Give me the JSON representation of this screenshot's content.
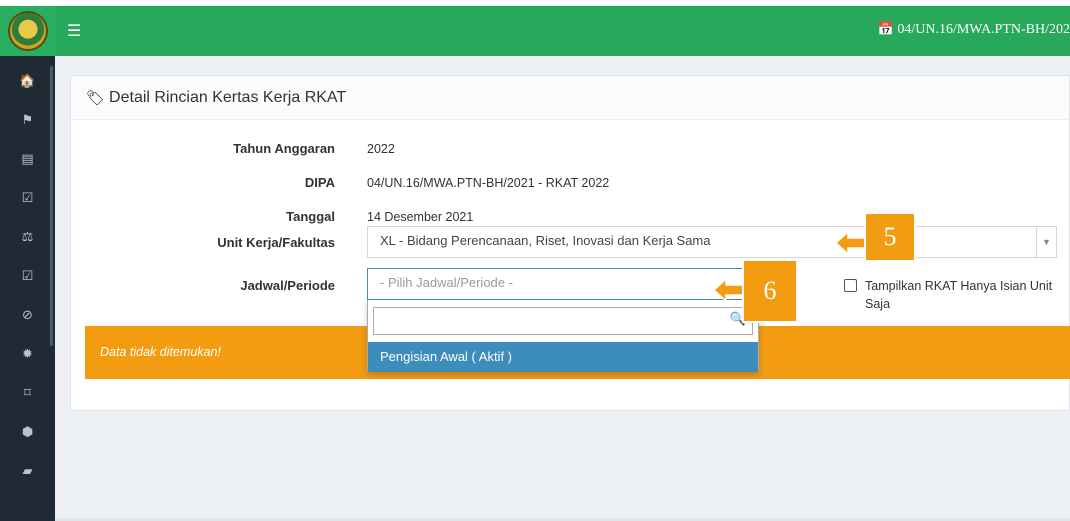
{
  "topbar": {
    "menu_icon": "hamburger-icon",
    "right_icon": "calendar-icon",
    "right_text": "04/UN.16/MWA.PTN-BH/202"
  },
  "sidebar": {
    "items": [
      {
        "icon": "home-icon",
        "glyph": "🏠"
      },
      {
        "icon": "flag-icon",
        "glyph": "⚑"
      },
      {
        "icon": "file-icon",
        "glyph": "▤"
      },
      {
        "icon": "check-square-icon",
        "glyph": "☑"
      },
      {
        "icon": "balance-scale-icon",
        "glyph": "⚖"
      },
      {
        "icon": "check-square-icon",
        "glyph": "☑"
      },
      {
        "icon": "ban-icon",
        "glyph": "⊘"
      },
      {
        "icon": "gear-icon",
        "glyph": "✹"
      },
      {
        "icon": "bookmark-icon",
        "glyph": "⌑"
      },
      {
        "icon": "cube-icon",
        "glyph": "⬢"
      },
      {
        "icon": "book-icon",
        "glyph": "▰"
      }
    ]
  },
  "panel": {
    "title_icon": "tag-icon",
    "title": "Detail Rincian Kertas Kerja RKAT"
  },
  "form": {
    "tahun_label": "Tahun Anggaran",
    "tahun_value": "2022",
    "dipa_label": "DIPA",
    "dipa_value": "04/UN.16/MWA.PTN-BH/2021 - RKAT 2022",
    "tanggal_label": "Tanggal",
    "tanggal_value": "14 Desember 2021",
    "unit_label": "Unit Kerja/Fakultas",
    "unit_value": "XL - Bidang Perencanaan, Riset, Inovasi dan Kerja Sama",
    "jadwal_label": "Jadwal/Periode",
    "jadwal_placeholder": "- Pilih Jadwal/Periode -",
    "dropdown_option": "Pengisian Awal ( Aktif )",
    "checkbox_label": "Tampilkan RKAT Hanya Isian Unit Saja"
  },
  "alert": {
    "text": "Data tidak ditemukan!"
  },
  "callouts": {
    "first": "5",
    "second": "6",
    "color": "#f39c12"
  }
}
